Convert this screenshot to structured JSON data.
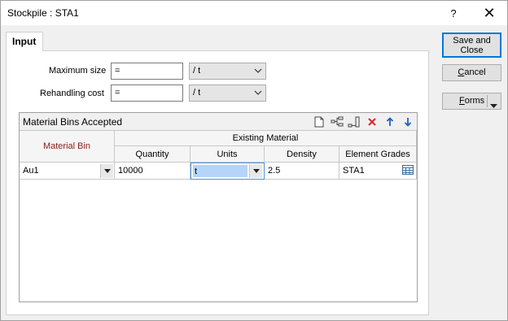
{
  "window": {
    "title": "Stockpile : STA1",
    "help_label": "?",
    "close_label": "✕"
  },
  "tabs": [
    {
      "label": "Input"
    }
  ],
  "form": {
    "max_size": {
      "label": "Maximum size",
      "value": "=",
      "unit": "/ t"
    },
    "rehandling_cost": {
      "label": "Rehandling cost",
      "value": "=",
      "unit": "/ t"
    }
  },
  "material_bins": {
    "title": "Material Bins Accepted",
    "toolbar_icons": [
      "new-icon",
      "insert-row-icon",
      "append-row-icon",
      "delete-icon",
      "move-up-icon",
      "move-down-icon"
    ],
    "header": {
      "material_bin": "Material Bin",
      "existing_material": "Existing Material",
      "columns": [
        "Quantity",
        "Units",
        "Density",
        "Element Grades"
      ]
    },
    "rows": [
      {
        "bin": "Au1",
        "quantity": "10000",
        "units": "t",
        "density": "2.5",
        "grades": "STA1"
      }
    ]
  },
  "buttons": {
    "save_close_line1": "Save and",
    "save_close_line2": "Close",
    "cancel_first": "C",
    "cancel_rest": "ancel",
    "forms_first": "F",
    "forms_rest": "orms"
  },
  "colors": {
    "material_bin_header": "#8b1a1a",
    "delete_icon": "#d9262c",
    "arrow_icon": "#1f5fbf",
    "accent": "#0078d7"
  }
}
